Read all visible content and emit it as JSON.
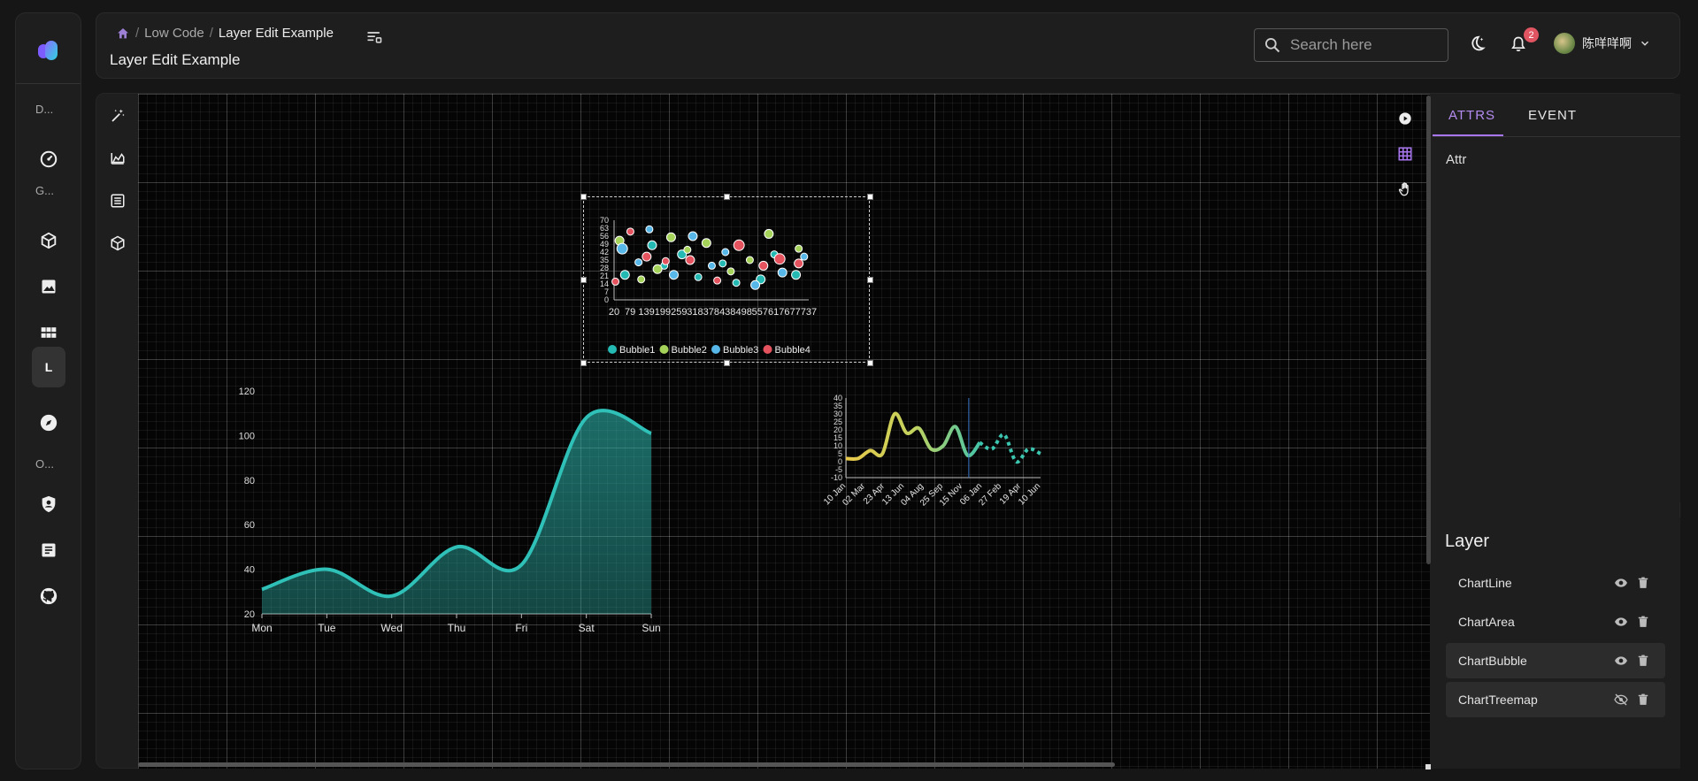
{
  "header": {
    "breadcrumb": [
      "Low Code",
      "Layer Edit Example"
    ],
    "title": "Layer Edit Example",
    "search_placeholder": "Search here",
    "notification_count": "2",
    "username": "陈咩咩啊"
  },
  "sidebar": {
    "sections": [
      "D...",
      "G...",
      "O..."
    ],
    "active_item": "L"
  },
  "panel": {
    "tabs": [
      "ATTRS",
      "EVENT"
    ],
    "attr_label": "Attr"
  },
  "layers": {
    "title": "Layer",
    "items": [
      {
        "name": "ChartLine",
        "visible": true
      },
      {
        "name": "ChartArea",
        "visible": true
      },
      {
        "name": "ChartBubble",
        "visible": true
      },
      {
        "name": "ChartTreemap",
        "visible": false
      }
    ]
  },
  "colors": {
    "accent": "#a877ef",
    "area": "#2fc1b8",
    "bubble1": "#25b9b4",
    "bubble2": "#a6d35a",
    "bubble3": "#57b7e8",
    "bubble4": "#e5535f"
  },
  "chart_data": [
    {
      "type": "area",
      "categories": [
        "Mon",
        "Tue",
        "Wed",
        "Thu",
        "Fri",
        "Sat",
        "Sun"
      ],
      "values": [
        31,
        40,
        28,
        50,
        42,
        108,
        101
      ],
      "ylim": [
        20,
        120
      ],
      "yticks": [
        20,
        40,
        60,
        80,
        100,
        120
      ],
      "grid": false
    },
    {
      "type": "scatter",
      "subtype": "bubble",
      "xticks": [
        20,
        79,
        139,
        199,
        259,
        318,
        378,
        438,
        498,
        557,
        617,
        677,
        737
      ],
      "yticks": [
        0,
        7,
        14,
        21,
        28,
        35,
        42,
        49,
        56,
        63,
        70
      ],
      "series": [
        {
          "name": "Bubble1",
          "points": [
            [
              60,
              22,
              5
            ],
            [
              160,
              48,
              5
            ],
            [
              205,
              30,
              4
            ],
            [
              270,
              40,
              5
            ],
            [
              330,
              20,
              4
            ],
            [
              420,
              32,
              4
            ],
            [
              470,
              15,
              4
            ],
            [
              560,
              18,
              5
            ],
            [
              610,
              40,
              4
            ],
            [
              690,
              22,
              5
            ]
          ]
        },
        {
          "name": "Bubble2",
          "points": [
            [
              40,
              52,
              5
            ],
            [
              120,
              18,
              4
            ],
            [
              180,
              27,
              5
            ],
            [
              230,
              55,
              5
            ],
            [
              290,
              44,
              4
            ],
            [
              360,
              50,
              5
            ],
            [
              450,
              25,
              4
            ],
            [
              520,
              35,
              4
            ],
            [
              590,
              58,
              5
            ],
            [
              700,
              45,
              4
            ]
          ]
        },
        {
          "name": "Bubble3",
          "points": [
            [
              50,
              45,
              6
            ],
            [
              110,
              33,
              4
            ],
            [
              150,
              62,
              4
            ],
            [
              240,
              22,
              5
            ],
            [
              310,
              56,
              5
            ],
            [
              380,
              30,
              4
            ],
            [
              430,
              42,
              4
            ],
            [
              540,
              13,
              5
            ],
            [
              640,
              24,
              5
            ],
            [
              720,
              38,
              4
            ]
          ]
        },
        {
          "name": "Bubble4",
          "points": [
            [
              25,
              16,
              4
            ],
            [
              80,
              60,
              4
            ],
            [
              140,
              38,
              5
            ],
            [
              210,
              34,
              4
            ],
            [
              300,
              35,
              5
            ],
            [
              400,
              17,
              4
            ],
            [
              480,
              48,
              6
            ],
            [
              570,
              30,
              5
            ],
            [
              630,
              36,
              6
            ],
            [
              700,
              32,
              5
            ]
          ]
        }
      ]
    },
    {
      "type": "line",
      "x": [
        "10 Jan",
        "02 Mar",
        "23 Apr",
        "13 Jun",
        "04 Aug",
        "25 Sep",
        "15 Nov",
        "06 Jan",
        "27 Feb",
        "19 Apr",
        "10 Jun"
      ],
      "values": [
        2,
        2,
        7,
        5,
        30,
        18,
        21,
        8,
        10,
        22,
        4,
        12,
        8,
        17,
        0,
        8,
        5
      ],
      "ylim": [
        -10,
        40
      ],
      "yticks": [
        -10,
        -5,
        0,
        5,
        10,
        15,
        20,
        25,
        30,
        35,
        40
      ],
      "forecast_from_index": 11
    }
  ]
}
